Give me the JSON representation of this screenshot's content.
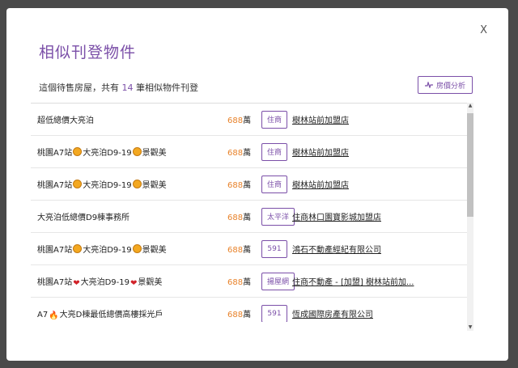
{
  "modal": {
    "title": "相似刊登物件",
    "close_label": "X",
    "summary_prefix": "這個待售房屋，共有",
    "summary_count": "14",
    "summary_suffix": "筆相似物件刊登",
    "analysis_button": "房價分析"
  },
  "listings": [
    {
      "name_parts": [
        "超低總價大亮泊"
      ],
      "price": "688",
      "unit": "萬",
      "source": "住商",
      "agency": "樹林站前加盟店"
    },
    {
      "name_parts": [
        "桃園A7站",
        "😁",
        "大亮泊D9-19",
        "😁",
        "景觀美"
      ],
      "price": "688",
      "unit": "萬",
      "source": "住商",
      "agency": "樹林站前加盟店"
    },
    {
      "name_parts": [
        "桃園A7站",
        "😁",
        "大亮泊D9-19",
        "😁",
        "景觀美"
      ],
      "price": "688",
      "unit": "萬",
      "source": "住商",
      "agency": "樹林站前加盟店"
    },
    {
      "name_parts": [
        "大亮泊低總價D9棟事務所"
      ],
      "price": "688",
      "unit": "萬",
      "source": "太平洋",
      "agency": "住商林口園寶影城加盟店"
    },
    {
      "name_parts": [
        "桃園A7站",
        "😁",
        "大亮泊D9-19",
        "😁",
        "景觀美"
      ],
      "price": "688",
      "unit": "萬",
      "source": "591",
      "agency": "鴻石不動產經紀有限公司"
    },
    {
      "name_parts": [
        "桃園A7站",
        "❤",
        "大亮泊D9-19",
        "❤",
        "景觀美"
      ],
      "price": "688",
      "unit": "萬",
      "source": "揚屋網",
      "agency": "住商不動產 - [加盟] 樹林站前加..."
    },
    {
      "name_parts": [
        "A7",
        "🔥",
        "大亮D棟最低總價高樓採光戶"
      ],
      "price": "688",
      "unit": "萬",
      "source": "591",
      "agency": "恆成國際房產有限公司"
    }
  ],
  "icons": {
    "analysis": "trend-line-icon",
    "scroll_up": "arrow-up-icon",
    "scroll_down": "arrow-down-icon"
  },
  "colors": {
    "accent": "#7b4fa8",
    "price": "#e8822a"
  }
}
